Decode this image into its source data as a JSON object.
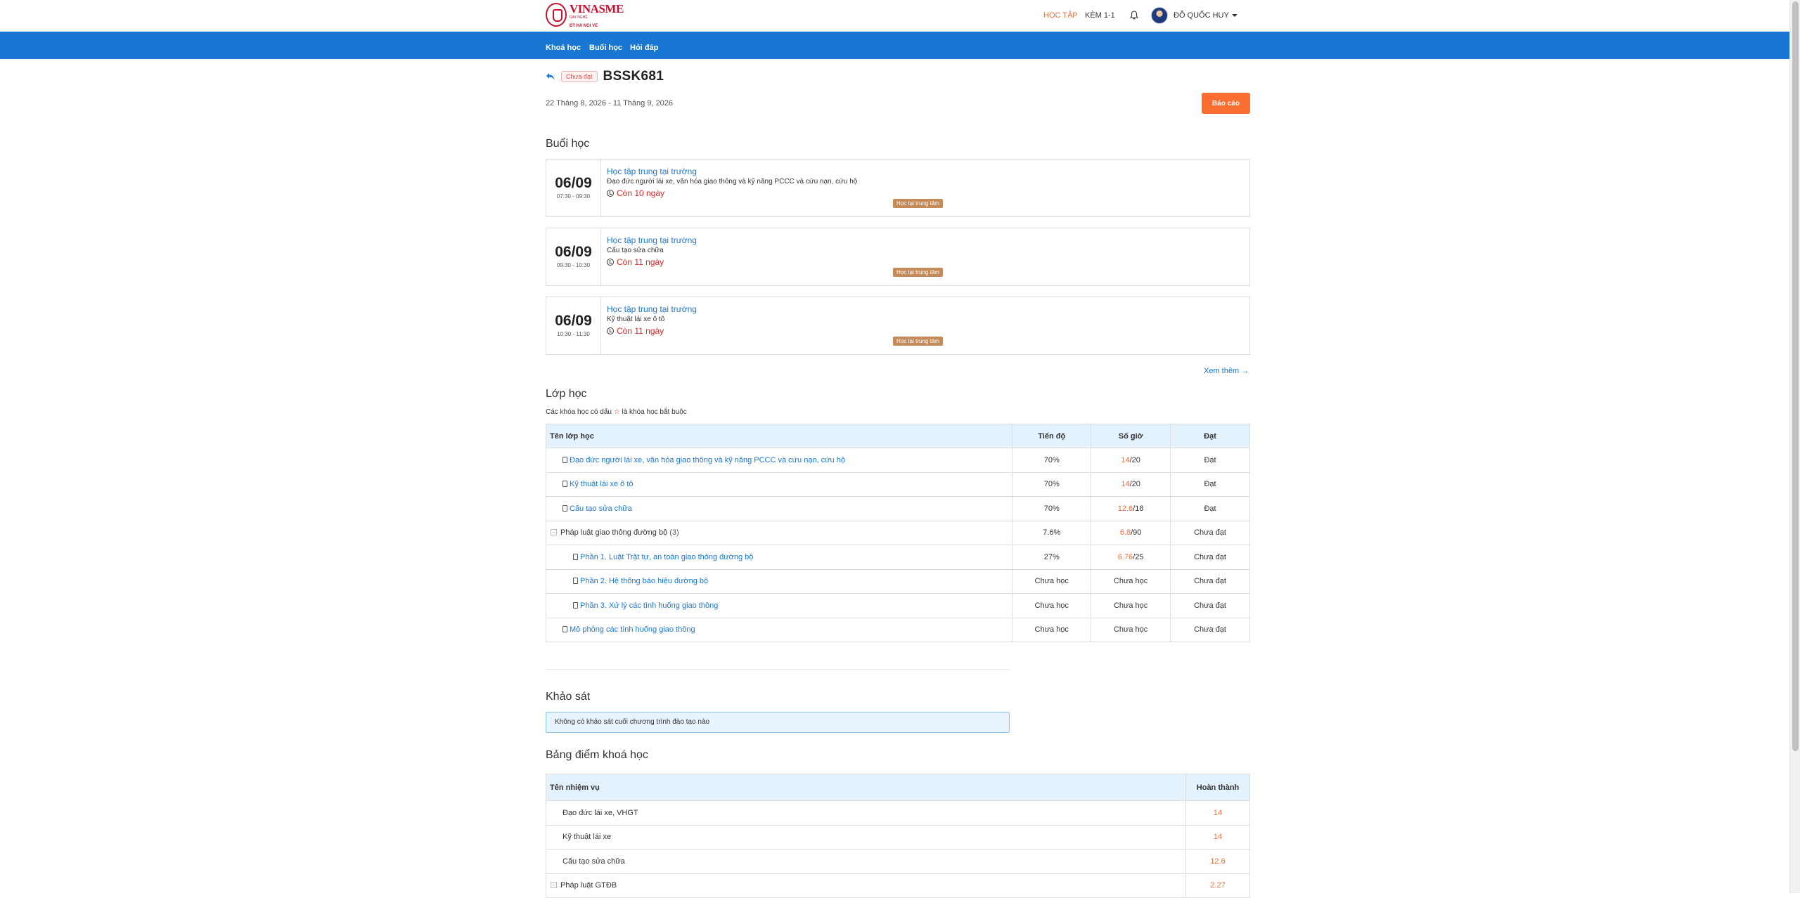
{
  "header": {
    "logo_name": "VINASME",
    "logo_sub": "DAY NGHỀ",
    "logo_sub2": "ĐT HA NGI VE",
    "nav_hoc_tap": "HỌC TẬP",
    "nav_kem": "KÈM 1-1",
    "user_name": "ĐỖ QUỐC HUY"
  },
  "navbar": {
    "items": [
      "Khoá học",
      "Buổi học",
      "Hỏi đáp"
    ]
  },
  "course": {
    "status": "Chưa đạt",
    "code": "BSSK681",
    "date_range": "22 Tháng 8, 2026 - 11 Tháng 9, 2026",
    "report_label": "Báo cáo"
  },
  "sessions_section": {
    "title": "Buổi học",
    "sessions": [
      {
        "day": "06/09",
        "time": "07:30 - 09:30",
        "title": "Học tập trung tại trường",
        "desc": "Đạo đức người lái xe, văn hóa giao thông và kỹ năng PCCC và cứu nạn, cứu hộ",
        "remain": "Còn 10 ngày",
        "tag": "Học tại trung tâm"
      },
      {
        "day": "06/09",
        "time": "09:30 - 10:30",
        "title": "Học tập trung tại trường",
        "desc": "Cấu tạo sửa chữa",
        "remain": "Còn 11 ngày",
        "tag": "Học tại trung tâm"
      },
      {
        "day": "06/09",
        "time": "10:30 - 11:30",
        "title": "Học tập trung tại trường",
        "desc": "Kỹ thuật lái xe ô tô",
        "remain": "Còn 11 ngày",
        "tag": "Học tại trung tâm"
      }
    ],
    "see_more": "Xem thêm"
  },
  "classes_section": {
    "title": "Lớp học",
    "note_before": "Các khóa học có dấu",
    "note_star": "☆",
    "note_after": "là khóa học bắt buộc",
    "headers": {
      "name": "Tên lớp học",
      "progress": "Tiến độ",
      "hours": "Số giờ",
      "pass": "Đạt"
    },
    "rows": [
      {
        "name": "Đạo đức người lái xe, văn hóa giao thông và kỹ năng PCCC và cứu nạn, cứu hộ",
        "progress": "70%",
        "hours_done": "14",
        "hours_total": "/20",
        "pass": "Đạt"
      },
      {
        "name": "Kỹ thuật lái xe ô tô",
        "progress": "70%",
        "hours_done": "14",
        "hours_total": "/20",
        "pass": "Đạt"
      },
      {
        "name": "Cấu tạo sửa chữa",
        "progress": "70%",
        "hours_done": "12.6",
        "hours_total": "/18",
        "pass": "Đạt"
      },
      {
        "name": "Pháp luật giao thông đường bộ",
        "count": "(3)",
        "progress": "7.6%",
        "hours_done": "6.8",
        "hours_total": "/90",
        "pass": "Chưa đạt"
      },
      {
        "name": "Phần 1. Luật Trật tự, an toàn giao thông đường bộ",
        "progress": "27%",
        "hours_done": "6.76",
        "hours_total": "/25",
        "pass": "Chưa đạt"
      },
      {
        "name": "Phần 2. Hệ thống báo hiệu đường bộ",
        "progress": "Chưa học",
        "hours_text": "Chưa học",
        "pass": "Chưa đạt"
      },
      {
        "name": "Phần 3. Xử lý các tình huống giao thông",
        "progress": "Chưa học",
        "hours_text": "Chưa học",
        "pass": "Chưa đạt"
      },
      {
        "name": "Mô phỏng các tình huống giao thông",
        "progress": "Chưa học",
        "hours_text": "Chưa học",
        "pass": "Chưa đạt"
      }
    ]
  },
  "survey_section": {
    "title": "Khảo sát",
    "message": "Không có khảo sát cuối chương trình đào tạo nào"
  },
  "scores_section": {
    "title": "Bảng điểm khoá học",
    "headers": {
      "name": "Tên nhiệm vụ",
      "done": "Hoàn thành"
    },
    "rows": [
      {
        "name": "Đạo đức lái xe, VHGT",
        "value": "14"
      },
      {
        "name": "Kỹ thuật lái xe",
        "value": "14"
      },
      {
        "name": "Cấu tạo sửa chữa",
        "value": "12.6"
      },
      {
        "name": "Pháp luật GTĐB",
        "value": "2.27"
      }
    ]
  },
  "colors": {
    "primary": "#1976d2",
    "accent": "#f96d31",
    "danger": "#e02424",
    "tag": "#c48a5a"
  }
}
